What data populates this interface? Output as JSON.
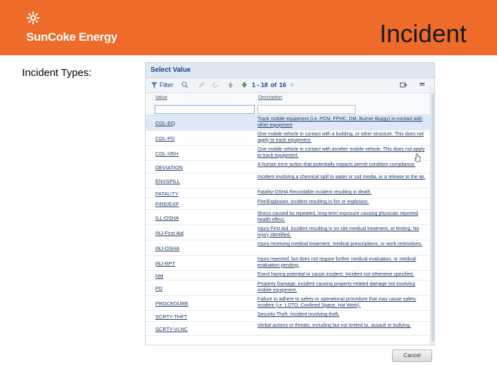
{
  "header": {
    "logo_text": "SunCoke Energy",
    "title": "Incident",
    "accent_color": "#ee6b2a"
  },
  "subtitle": "Incident Types:",
  "dialog": {
    "title": "Select Value",
    "toolbar": {
      "filter_label": "Filter",
      "pager": {
        "range": "1 - 18",
        "of_label": "of",
        "total": "16"
      }
    },
    "columns": {
      "value": "Value",
      "description": "Description"
    },
    "rows": [
      {
        "value": "COL-EQ",
        "description": "Track mobile equipment (i.e. PCM, FPHC, DM, Burner Buggy) in-contact with other equipment"
      },
      {
        "value": "COL-PD",
        "description": "One mobile vehicle in contact with a building, or other structure. This does not apply to track equipment."
      },
      {
        "value": "COL-VEH",
        "description": "One mobile vehicle in contact with another mobile vehicle. This does not apply to track equipment."
      },
      {
        "value": "DEVIATION",
        "description": "A human error action that potentially impacts permit condition compliance."
      },
      {
        "value": "ENVSPILL",
        "description": "Incident involving a chemical spill to water or soil media, or a release to the air."
      },
      {
        "value": "FATALITY",
        "description": "Fatality-OSHA Recordable incident resulting in death."
      },
      {
        "value": "FIRE/EXP",
        "description": "Fire/Explosion: incident resulting in fire or explosion."
      },
      {
        "value": "ILL-OSHA",
        "description": "Illness caused by repeated, long-term exposure causing physician reported health effect."
      },
      {
        "value": "INJ-First Aid",
        "description": "Injury First Aid. Incident resulting in on site medical treatment, or testing. No injury identified."
      },
      {
        "value": "INJ-OSHA",
        "description": "Injury receiving medical treatment, medical prescriptions, or work restrictions."
      },
      {
        "value": "INJ-RPT",
        "description": "Injury reported, but does not require further medical evaluation, or medical evaluation pending."
      },
      {
        "value": "NM",
        "description": "Event having potential to cause incident. Incident not otherwise specified."
      },
      {
        "value": "PD",
        "description": "Property Damage, incident causing property-related damage not involving mobile equipment."
      },
      {
        "value": "PROCEDURE",
        "description": "Failure to adhere to safety or operational procedure that may cause safety incident (i.e. LOTO, Confined Space, Hot Work)."
      },
      {
        "value": "SCRTY-THFT",
        "description": "Security-Theft. Incident involving theft."
      },
      {
        "value": "SCRTY-VLNC",
        "description": "Verbal actions or threats, including but not limited to, assault or bullying."
      }
    ],
    "cancel_label": "Cancel"
  }
}
